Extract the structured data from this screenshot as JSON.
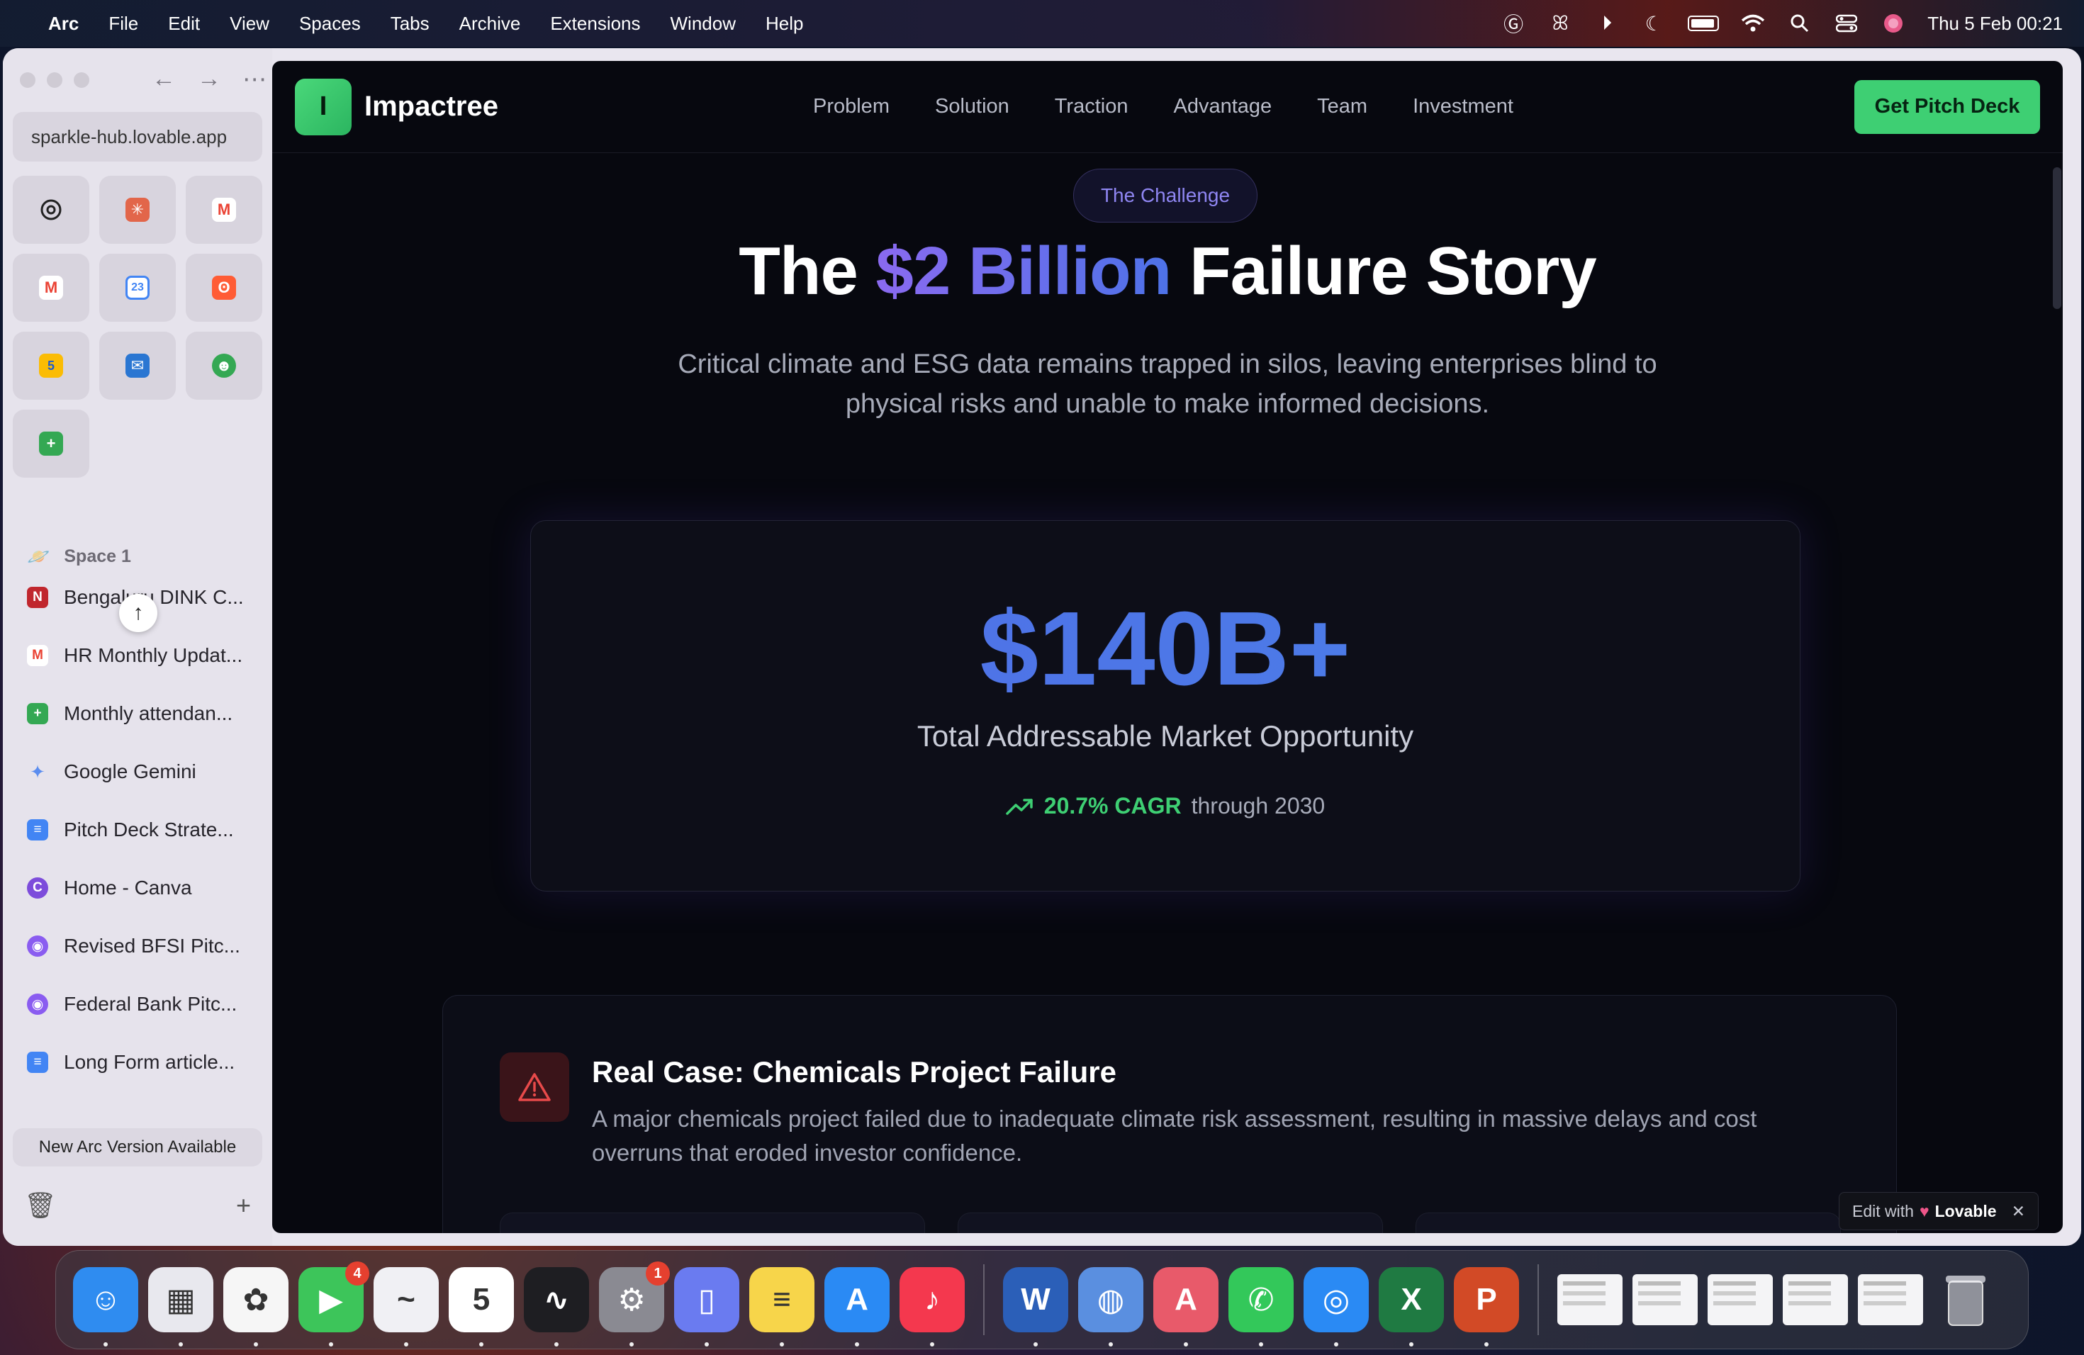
{
  "menubar": {
    "app_name": "Arc",
    "menus": [
      "File",
      "Edit",
      "View",
      "Spaces",
      "Tabs",
      "Archive",
      "Extensions",
      "Window",
      "Help"
    ],
    "clock": "Thu 5 Feb  00:21"
  },
  "sidebar": {
    "url": "sparkle-hub.lovable.app",
    "favorites": [
      {
        "icon": "chatgpt-icon",
        "color": "#222"
      },
      {
        "icon": "claude-icon",
        "color": "#e2664a"
      },
      {
        "icon": "gmail-icon",
        "color": "#ea4335"
      },
      {
        "icon": "gmail-icon",
        "color": "#ea4335"
      },
      {
        "icon": "google-calendar-icon",
        "color": "#4285f4"
      },
      {
        "icon": "hubspot-icon",
        "color": "#ff5c35"
      },
      {
        "icon": "calendar-icon",
        "color": "#fbbc04"
      },
      {
        "icon": "outlook-icon",
        "color": "#2a76d2"
      },
      {
        "icon": "bot-icon",
        "color": "#34a853"
      },
      {
        "icon": "google-sheets-icon",
        "color": "#34a853"
      }
    ],
    "space_name": "Space 1",
    "tabs": [
      {
        "label": "Bengaluru DINK C...",
        "icon": "notion-icon",
        "color": "#c0262d",
        "glyph": "N"
      },
      {
        "label": "HR Monthly Updat...",
        "icon": "gmail-icon",
        "color": "#ea4335",
        "glyph": "M"
      },
      {
        "label": "Monthly attendan...",
        "icon": "google-sheets-icon",
        "color": "#34a853",
        "glyph": "+"
      },
      {
        "label": "Google Gemini",
        "icon": "gemini-icon",
        "color": "#5b8def",
        "glyph": "✦"
      },
      {
        "label": "Pitch Deck Strate...",
        "icon": "google-docs-icon",
        "color": "#4285f4",
        "glyph": "≡"
      },
      {
        "label": "Home - Canva",
        "icon": "canva-icon",
        "color": "#7d4cdb",
        "glyph": "C"
      },
      {
        "label": "Revised BFSI Pitc...",
        "icon": "lovable-icon",
        "color": "#8a5cf0",
        "glyph": "◉"
      },
      {
        "label": "Federal Bank Pitc...",
        "icon": "lovable-icon",
        "color": "#8a5cf0",
        "glyph": "◉"
      },
      {
        "label": "Long Form article...",
        "icon": "google-docs-icon",
        "color": "#4285f4",
        "glyph": "≡"
      }
    ],
    "update_notice": "New Arc Version Available"
  },
  "site": {
    "logo_letter": "I",
    "logo_name": "Impactree",
    "nav": [
      "Problem",
      "Solution",
      "Traction",
      "Advantage",
      "Team",
      "Investment"
    ],
    "cta": "Get Pitch Deck",
    "badge": "The Challenge",
    "headline_pre": "The ",
    "headline_accent": "$2 Billion",
    "headline_post": " Failure Story",
    "subtitle": "Critical climate and ESG data remains trapped in silos, leaving enterprises blind to physical risks and unable to make informed decisions.",
    "stat_value": "$140B+",
    "stat_label": "Total Addressable Market Opportunity",
    "stat_cagr": "20.7% CAGR",
    "stat_through": "through 2030",
    "case_title": "Real Case: Chemicals Project Failure",
    "case_text": "A major chemicals project failed due to inadequate climate risk assessment, resulting in massive delays and cost overruns that eroded investor confidence.",
    "edit_with": "Edit with",
    "edit_brand": "Lovable"
  },
  "colors": {
    "accent_green": "#3ecf73",
    "accent_purple": "#8a6af0",
    "accent_blue": "#4f6ce8",
    "page_bg": "#07080f"
  },
  "dock": {
    "apps": [
      {
        "name": "finder-icon",
        "color": "#2f8cf0",
        "glyph": "☺"
      },
      {
        "name": "launchpad-icon",
        "color": "#e8e8ee",
        "glyph": "▦"
      },
      {
        "name": "photos-icon",
        "color": "#f6f6f6",
        "glyph": "✿"
      },
      {
        "name": "facetime-icon",
        "color": "#3dc55a",
        "glyph": "▶",
        "badge": "4"
      },
      {
        "name": "freeform-icon",
        "color": "#f0f0f4",
        "glyph": "~"
      },
      {
        "name": "calendar-icon",
        "color": "#ffffff",
        "glyph": "5"
      },
      {
        "name": "activity-monitor-icon",
        "color": "#1e1e22",
        "glyph": "∿"
      },
      {
        "name": "system-settings-icon",
        "color": "#8a8a92",
        "glyph": "⚙",
        "badge": "1"
      },
      {
        "name": "iphone-mirroring-icon",
        "color": "#6a7bf0",
        "glyph": "▯"
      },
      {
        "name": "notes-icon",
        "color": "#f7d54a",
        "glyph": "≡"
      },
      {
        "name": "app-store-icon",
        "color": "#2a8af4",
        "glyph": "A"
      },
      {
        "name": "music-icon",
        "color": "#f4384e",
        "glyph": "♪"
      }
    ],
    "apps2": [
      {
        "name": "word-icon",
        "color": "#2b5fb8",
        "glyph": "W"
      },
      {
        "name": "cloud-app-icon",
        "color": "#5a8fe0",
        "glyph": "◍"
      },
      {
        "name": "arc-icon",
        "color": "#e85a6a",
        "glyph": "A"
      },
      {
        "name": "whatsapp-icon",
        "color": "#33c85a",
        "glyph": "✆"
      },
      {
        "name": "safari-icon",
        "color": "#2a8af4",
        "glyph": "◎"
      },
      {
        "name": "excel-icon",
        "color": "#1f7a42",
        "glyph": "X"
      },
      {
        "name": "powerpoint-icon",
        "color": "#d24a26",
        "glyph": "P"
      }
    ],
    "thumbs": 5
  }
}
